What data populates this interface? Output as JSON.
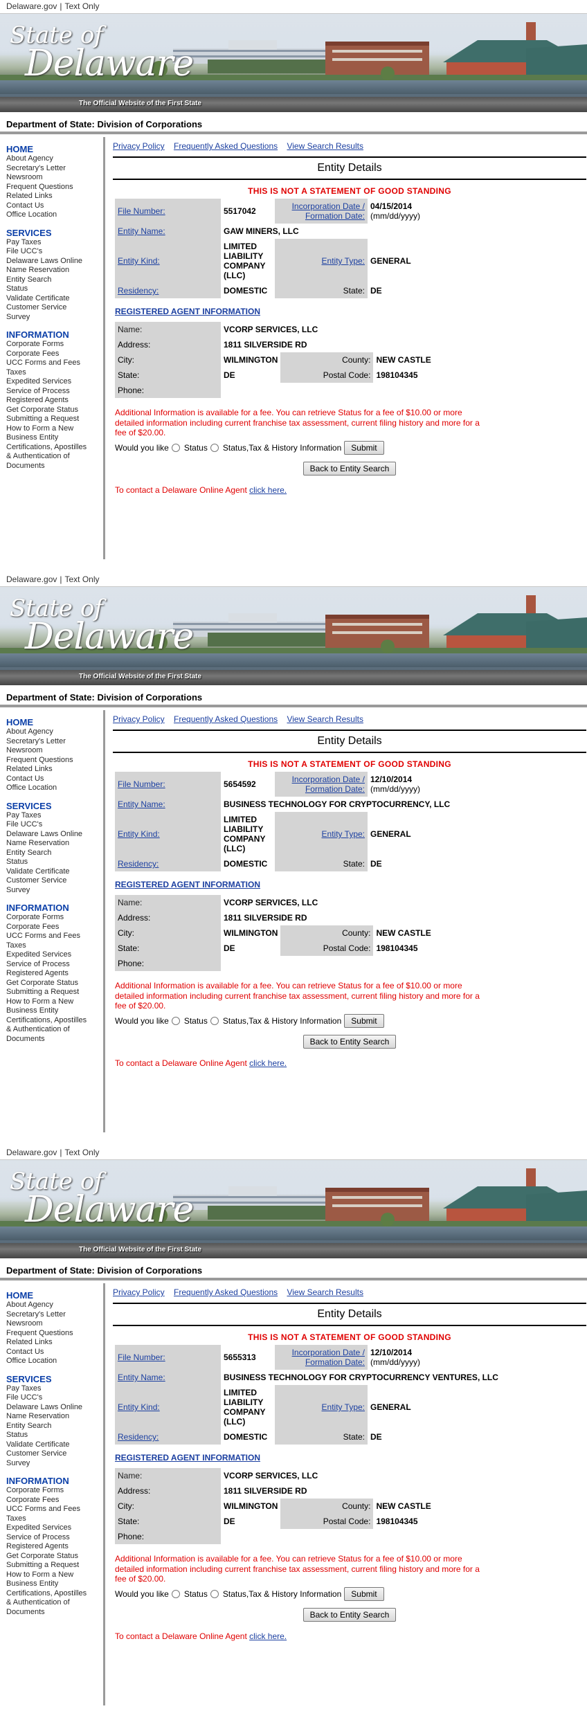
{
  "topbar": {
    "site": "Delaware.gov",
    "sep": "|",
    "text_only": "Text Only"
  },
  "banner": {
    "logo_state": "State of",
    "logo_name": "Delaware",
    "tagline": "The Official Website of the First State"
  },
  "department": "Department of State: Division of Corporations",
  "sidebar": {
    "home": {
      "title": "HOME",
      "items": [
        "About Agency",
        "Secretary's Letter",
        "Newsroom",
        "Frequent Questions",
        "Related Links",
        "Contact Us",
        "Office Location"
      ]
    },
    "services": {
      "title": "SERVICES",
      "items": [
        "Pay Taxes",
        "File UCC's",
        "Delaware Laws Online",
        "Name Reservation",
        "Entity Search",
        "Status",
        "Validate Certificate",
        "Customer Service",
        "Survey"
      ]
    },
    "information": {
      "title": "INFORMATION",
      "items": [
        "Corporate Forms",
        "Corporate Fees",
        "UCC Forms and Fees",
        "Taxes",
        "Expedited Services",
        "Service of Process",
        "Registered Agents",
        "Get Corporate Status",
        "Submitting a Request",
        "How to Form a New",
        "Business Entity",
        "Certifications, Apostilles",
        "& Authentication of",
        "Documents"
      ]
    }
  },
  "links": {
    "privacy": "Privacy Policy",
    "faq": "Frequently Asked Questions",
    "results": "View Search Results"
  },
  "labels": {
    "entity_details": "Entity Details",
    "warning": "THIS IS NOT A STATEMENT OF GOOD STANDING",
    "file_number": "File Number:",
    "inc_date_1": "Incorporation Date /",
    "inc_date_2": "Formation Date:",
    "date_fmt": "(mm/dd/yyyy)",
    "entity_name": "Entity Name:",
    "entity_kind": "Entity Kind:",
    "entity_type": "Entity Type:",
    "residency": "Residency:",
    "state": "State:",
    "reg_agent_info": "REGISTERED AGENT INFORMATION",
    "name": "Name:",
    "address": "Address:",
    "city": "City:",
    "county": "County:",
    "postal": "Postal Code:",
    "phone": "Phone:",
    "additional": "Additional Information is available for a fee. You can retrieve Status for a fee of $10.00 or more detailed information including current franchise tax assessment, current filing history and more for a fee of $20.00.",
    "would_you": "Would you like",
    "opt_status": "Status",
    "opt_full": "Status,Tax & History Information",
    "submit": "Submit",
    "back": "Back to Entity Search",
    "contact": "To contact a Delaware Online Agent",
    "click_here": "click here."
  },
  "entities": [
    {
      "file_number": "5517042",
      "inc_date": "04/15/2014",
      "name": "GAW MINERS, LLC",
      "kind": [
        "LIMITED",
        "LIABILITY",
        "COMPANY",
        "(LLC)"
      ],
      "type": "GENERAL",
      "residency": "DOMESTIC",
      "state": "DE",
      "agent": {
        "name": "VCORP SERVICES, LLC",
        "address": "1811 SILVERSIDE RD",
        "city": "WILMINGTON",
        "county": "NEW CASTLE",
        "state": "DE",
        "postal": "198104345",
        "phone": ""
      }
    },
    {
      "file_number": "5654592",
      "inc_date": "12/10/2014",
      "name": "BUSINESS TECHNOLOGY FOR CRYPTOCURRENCY, LLC",
      "kind": [
        "LIMITED",
        "LIABILITY",
        "COMPANY",
        "(LLC)"
      ],
      "type": "GENERAL",
      "residency": "DOMESTIC",
      "state": "DE",
      "agent": {
        "name": "VCORP SERVICES, LLC",
        "address": "1811 SILVERSIDE RD",
        "city": "WILMINGTON",
        "county": "NEW CASTLE",
        "state": "DE",
        "postal": "198104345",
        "phone": ""
      }
    },
    {
      "file_number": "5655313",
      "inc_date": "12/10/2014",
      "name": "BUSINESS TECHNOLOGY FOR CRYPTOCURRENCY VENTURES, LLC",
      "kind": [
        "LIMITED",
        "LIABILITY",
        "COMPANY",
        "(LLC)"
      ],
      "type": "GENERAL",
      "residency": "DOMESTIC",
      "state": "DE",
      "agent": {
        "name": "VCORP SERVICES, LLC",
        "address": "1811 SILVERSIDE RD",
        "city": "WILMINGTON",
        "county": "NEW CASTLE",
        "state": "DE",
        "postal": "198104345",
        "phone": ""
      }
    }
  ],
  "colors": {
    "link": "#1b3fa0",
    "nav_heading": "#0b3fa8",
    "warning": "#e00000",
    "label_bg": "#d4d4d4",
    "divider": "#9a9a9a"
  }
}
